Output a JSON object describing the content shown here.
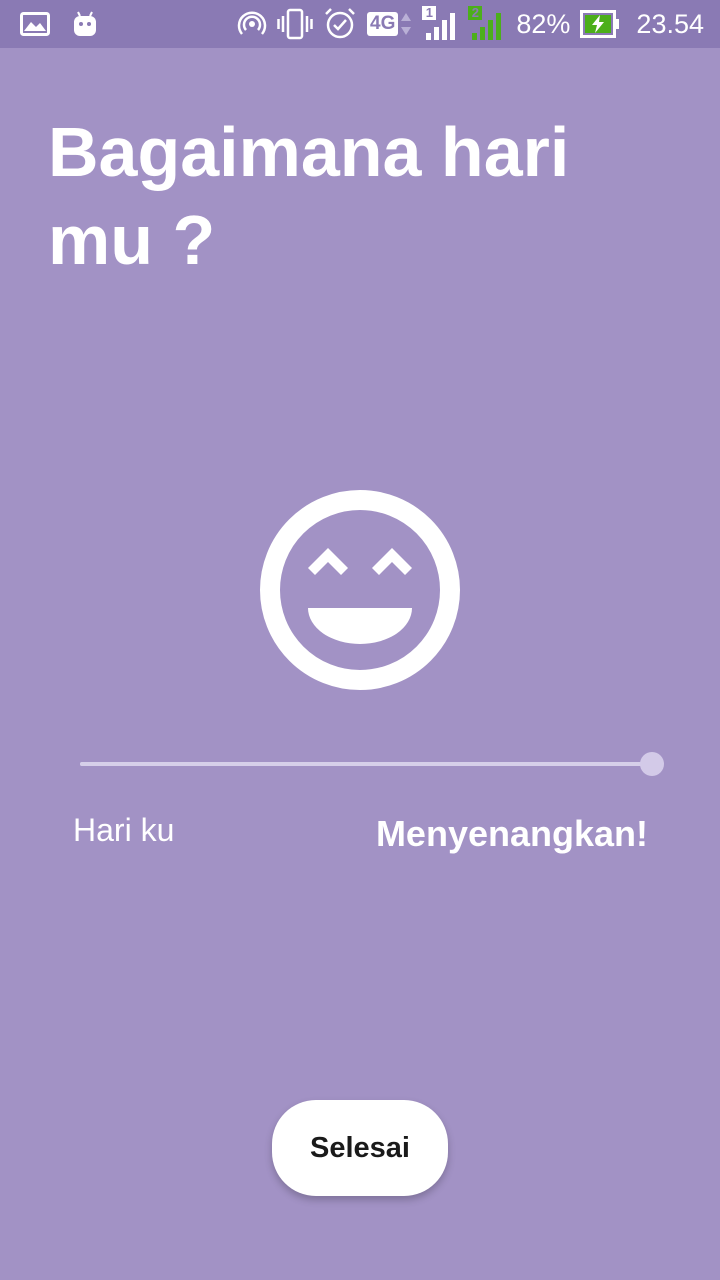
{
  "colors": {
    "background": "#a292c5",
    "status_bar": "#8a7ab4",
    "battery_fill": "#4caf1a"
  },
  "status_bar": {
    "left_icons": [
      "gallery-icon",
      "android-icon"
    ],
    "right_icons": [
      "hotspot-icon",
      "vibrate-icon",
      "alarm-icon",
      "network-4g-icon",
      "signal-sim1-icon",
      "signal-sim2-icon",
      "battery-charging-icon"
    ],
    "network_type": "4G",
    "sim1_label": "1",
    "sim2_label": "2",
    "battery_percent": "82%",
    "time": "23.54"
  },
  "title": "Bagaimana hari mu ?",
  "mood": {
    "icon": "laughing-face-icon",
    "slider_value": 1.0
  },
  "labels": {
    "prefix": "Hari ku",
    "mood_text": "Menyenangkan!"
  },
  "done_button": {
    "label": "Selesai"
  }
}
